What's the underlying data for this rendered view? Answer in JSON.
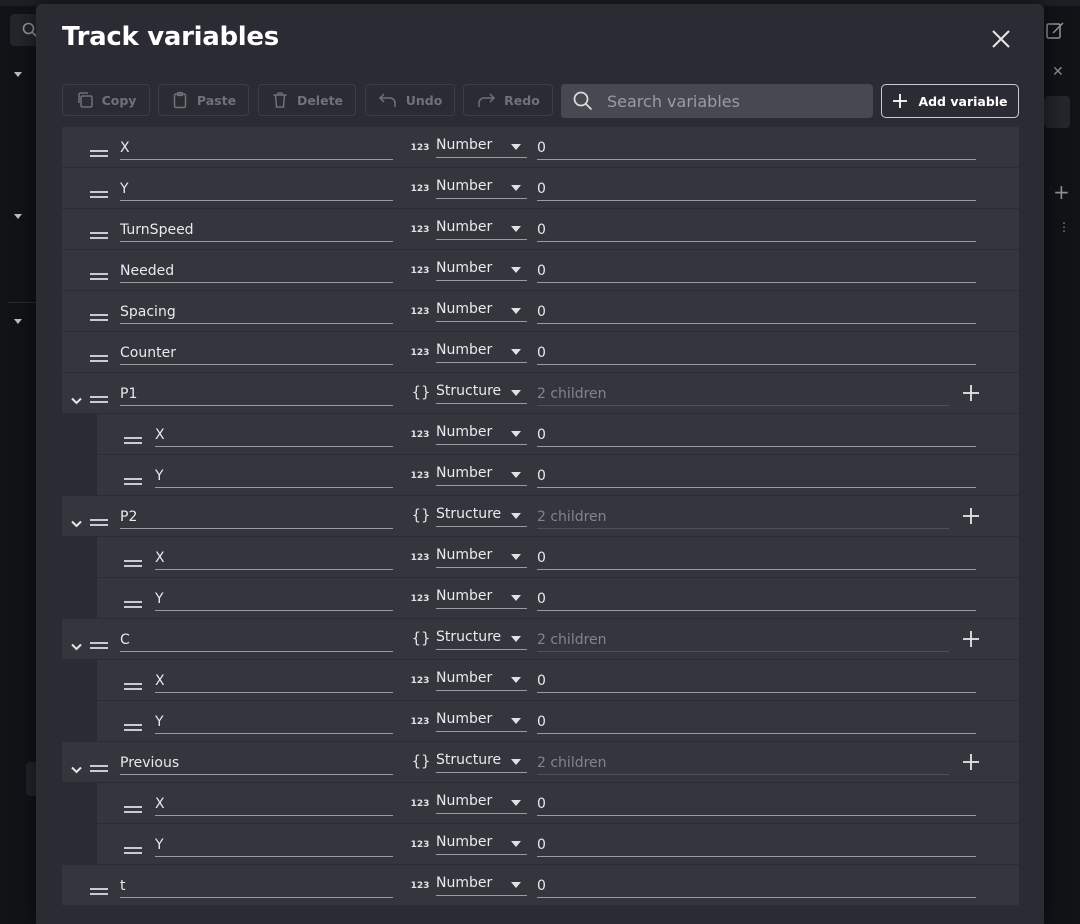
{
  "dialog": {
    "title": "Track variables"
  },
  "toolbar": {
    "copy_label": "Copy",
    "paste_label": "Paste",
    "delete_label": "Delete",
    "undo_label": "Undo",
    "redo_label": "Redo",
    "search_placeholder": "Search variables",
    "add_variable_label": "Add variable"
  },
  "type_icons": {
    "number": "123",
    "structure": "{}"
  },
  "variables": [
    {
      "name": "X",
      "type": "Number",
      "value": "0"
    },
    {
      "name": "Y",
      "type": "Number",
      "value": "0"
    },
    {
      "name": "TurnSpeed",
      "type": "Number",
      "value": "0"
    },
    {
      "name": "Needed",
      "type": "Number",
      "value": "0"
    },
    {
      "name": "Spacing",
      "type": "Number",
      "value": "0"
    },
    {
      "name": "Counter",
      "type": "Number",
      "value": "0"
    },
    {
      "name": "P1",
      "type": "Structure",
      "value": "2 children",
      "children": [
        {
          "name": "X",
          "type": "Number",
          "value": "0"
        },
        {
          "name": "Y",
          "type": "Number",
          "value": "0"
        }
      ]
    },
    {
      "name": "P2",
      "type": "Structure",
      "value": "2 children",
      "children": [
        {
          "name": "X",
          "type": "Number",
          "value": "0"
        },
        {
          "name": "Y",
          "type": "Number",
          "value": "0"
        }
      ]
    },
    {
      "name": "C",
      "type": "Structure",
      "value": "2 children",
      "children": [
        {
          "name": "X",
          "type": "Number",
          "value": "0"
        },
        {
          "name": "Y",
          "type": "Number",
          "value": "0"
        }
      ]
    },
    {
      "name": "Previous",
      "type": "Structure",
      "value": "2 children",
      "children": [
        {
          "name": "X",
          "type": "Number",
          "value": "0"
        },
        {
          "name": "Y",
          "type": "Number",
          "value": "0"
        }
      ]
    },
    {
      "name": "t",
      "type": "Number",
      "value": "0"
    }
  ],
  "colors": {
    "dialog_bg": "#2b2c33",
    "row_bg": "#35363d",
    "disabled_text": "#6f727a",
    "search_bg": "#474950"
  }
}
